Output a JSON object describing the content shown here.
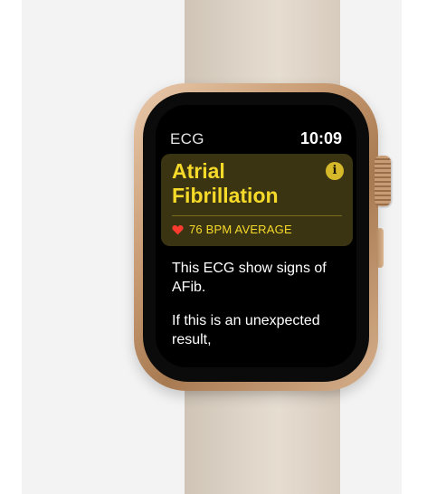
{
  "watch": {
    "app_name": "ECG",
    "time": "10:09",
    "alert": {
      "title": "Atrial Fibrillation",
      "info_glyph": "i",
      "bpm_text": "76 BPM AVERAGE",
      "icon": "heart-icon",
      "accent_color": "#f6da2a",
      "heart_color": "#ff3b30"
    },
    "messages": [
      "This ECG show signs of AFib.",
      "If this is an unexpected result,"
    ]
  }
}
